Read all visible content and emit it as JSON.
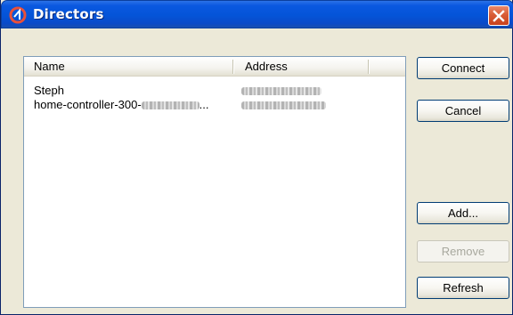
{
  "window": {
    "title": "Directors"
  },
  "list": {
    "columns": [
      "Name",
      "Address"
    ],
    "rows": [
      {
        "name": "Steph",
        "address": ""
      },
      {
        "name": "home-controller-300-",
        "name_suffix": "...",
        "address": ""
      }
    ]
  },
  "buttons": {
    "connect": "Connect",
    "cancel": "Cancel",
    "add": "Add...",
    "remove": "Remove",
    "refresh": "Refresh"
  },
  "colors": {
    "titlebar": "#0454d8",
    "dialog_bg": "#ece9d8",
    "close_button": "#d95d36",
    "disabled_text": "#a8a89e"
  },
  "icons": {
    "app": "control4-logo-icon",
    "close": "close-icon"
  }
}
